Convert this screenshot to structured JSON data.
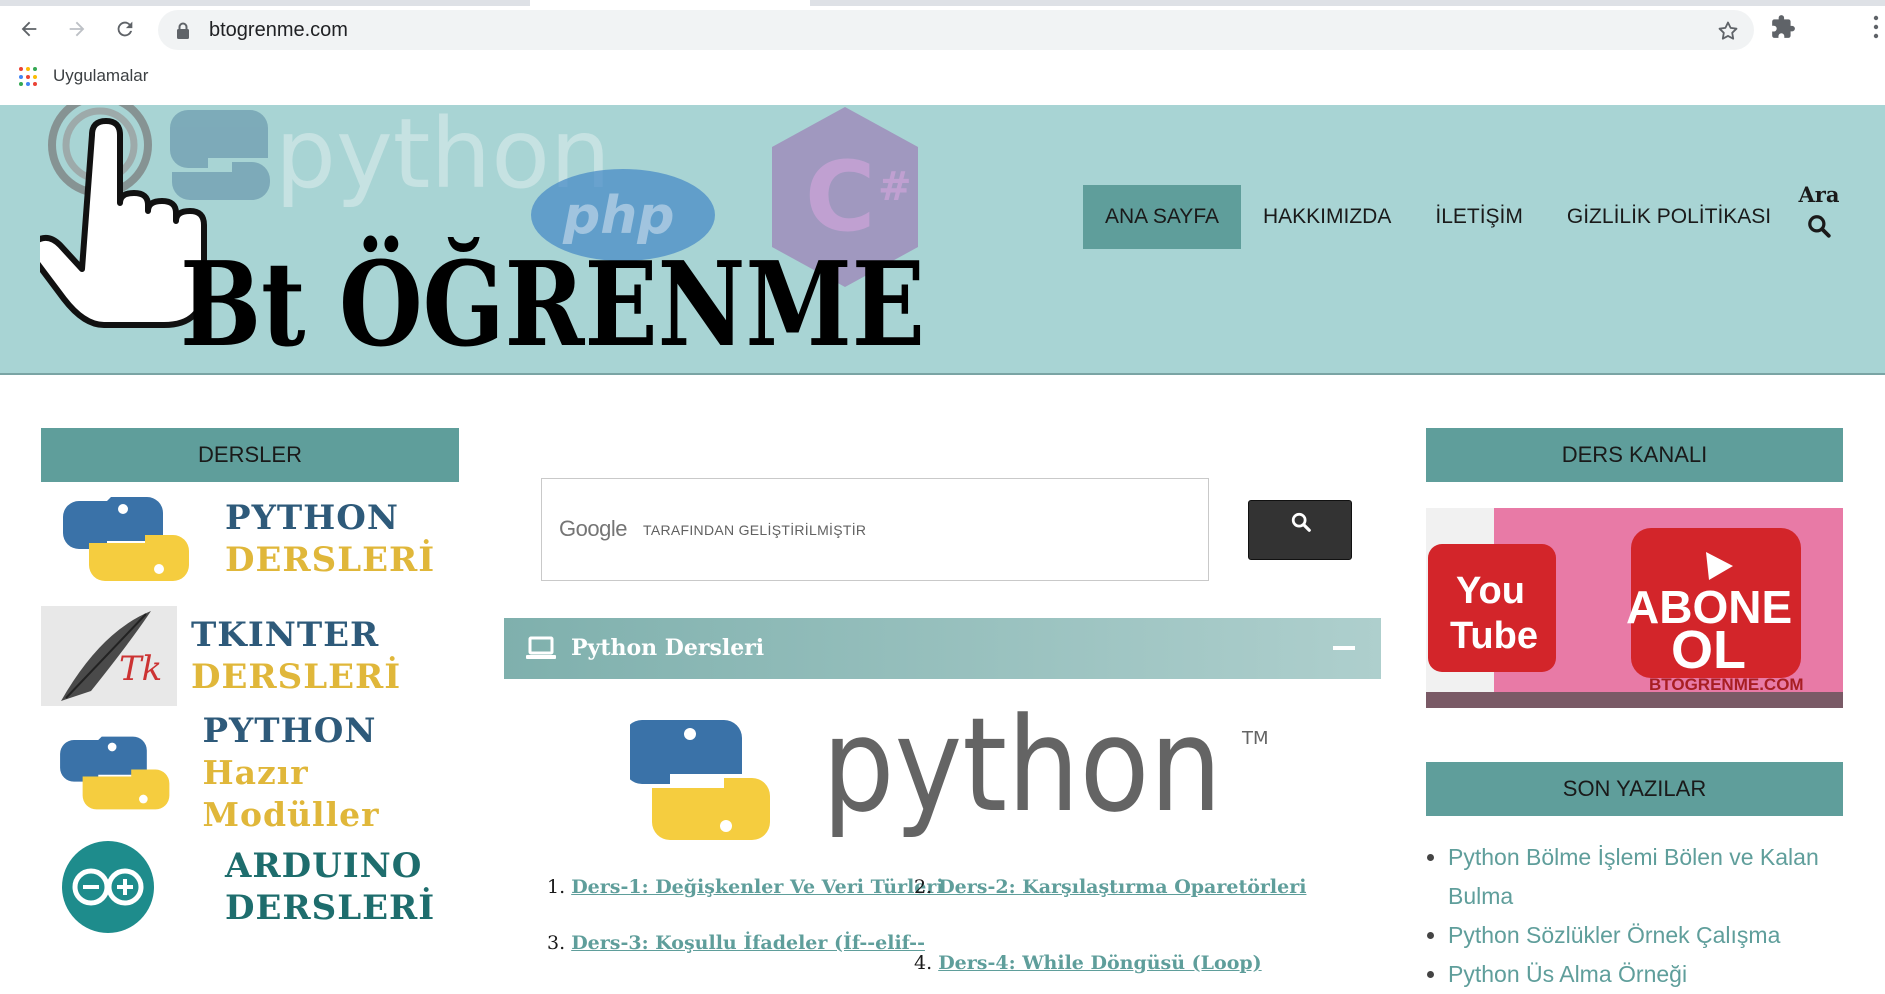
{
  "browser": {
    "url": "btogrenme.com",
    "bookmarks_label": "Uygulamalar"
  },
  "header": {
    "logo_text": "Bt ÖĞRENME",
    "logo_bg_words": [
      "python",
      "php",
      "C#"
    ],
    "menu": [
      {
        "label": "ANA SAYFA",
        "active": true
      },
      {
        "label": "HAKKIMIZDA",
        "active": false
      },
      {
        "label": "İLETİŞİM",
        "active": false
      },
      {
        "label": "GİZLİLİK POLİTİKASI",
        "active": false
      }
    ],
    "search_label": "Ara"
  },
  "left_sidebar": {
    "title": "DERSLER",
    "courses": [
      {
        "line1": "PYTHON",
        "line2": "DERSLERİ",
        "icon": "python-logo"
      },
      {
        "line1": "TKINTER",
        "line2": "DERSLERİ",
        "icon": "tk-feather-logo",
        "icon_text": "Tk"
      },
      {
        "line1": "PYTHON",
        "line2": "Hazır Modüller",
        "icon": "python-logo"
      },
      {
        "line1": "ARDUINO",
        "line2": "DERSLERİ",
        "icon": "arduino-logo"
      }
    ]
  },
  "center": {
    "search_brand": "Google",
    "search_text": "TARAFINDAN GELİŞTİRİLMİŞTİR",
    "accordion_title": "Python Dersleri",
    "python_word": "python",
    "python_tm": "TM",
    "lessons": [
      {
        "num": "1.",
        "label": "Ders-1: Değişkenler Ve Veri Türleri"
      },
      {
        "num": "2.",
        "label": "Ders-2: Karşılaştırma Oparetörleri"
      },
      {
        "num": "3.",
        "label": "Ders-3: Koşullu İfadeler (İf--elif--"
      },
      {
        "num": "4.",
        "label": "Ders-4: While Döngüsü (Loop)"
      }
    ]
  },
  "right_sidebar": {
    "channel_title": "DERS KANALI",
    "yt_you": "You",
    "yt_tube": "Tube",
    "yt_abone": "ABONE",
    "yt_ol": "OL",
    "yt_site": "BTOGRENME.COM",
    "recent_title": "SON YAZILAR",
    "recent_posts": [
      "Python Bölme İşlemi Bölen ve Kalan Bulma",
      "Python Sözlükler Örnek Çalışma",
      "Python Üs Alma Örneği"
    ]
  },
  "colors": {
    "header_bg": "#a8d4d4",
    "accent": "#5f9e9b",
    "link": "#5f9e9b"
  }
}
